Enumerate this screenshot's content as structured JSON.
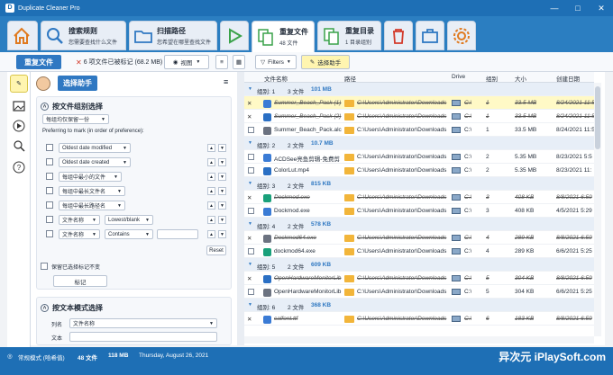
{
  "window": {
    "title": "Duplicate Cleaner Pro"
  },
  "ribbon": {
    "tabs": [
      {
        "title": "搜索规则",
        "subtitle": "您需要查找什么文件"
      },
      {
        "title": "扫描路径",
        "subtitle": "您希望在哪里查找文件"
      },
      {
        "title": "重复文件",
        "subtitle": "48 文件"
      },
      {
        "title": "重复目录",
        "subtitle": "1 目录组别"
      }
    ]
  },
  "toolbar": {
    "dup_button": "重复文件",
    "marked_summary": "6 项文件已被标记 (68.2 MB)",
    "view_label": "视图",
    "filters_label": "Filters",
    "selection_assistant": "选择助手"
  },
  "left": {
    "helper_title": "选择助手",
    "group_section": {
      "title": "按文件组别选择",
      "mode_value": "每组均仅保留一份",
      "prefer_label": "Preferring to mark (in order of preference):",
      "rules": [
        {
          "field": "Oldest date modified"
        },
        {
          "field": "Oldest date created"
        },
        {
          "field": "每组中最小的文件"
        },
        {
          "field": "每组中最长文件名"
        },
        {
          "field": "每组中最长路径名"
        },
        {
          "field": "文件名称",
          "operator": "Lowest/blank"
        },
        {
          "field": "文件名称",
          "operator": "Contains"
        }
      ],
      "reset_label": "Reset",
      "keep_marks_label": "保留已选择标记不变",
      "mark_button": "标记"
    },
    "text_section": {
      "title": "按文本模式选择",
      "column_label": "列名",
      "column_value": "文件名称",
      "text_label": "文本"
    }
  },
  "grid": {
    "headers": [
      "文件名称",
      "路径",
      "Drive",
      "组别",
      "大小",
      "创建日期"
    ],
    "rows": [
      {
        "type": "group",
        "label": "组别: 1",
        "count": "3 文件",
        "size": "101 MB"
      },
      {
        "type": "file",
        "marked": true,
        "highlight": true,
        "name": "Summer_Beach_Pack (1)",
        "path": "C:\\Users\\Administrator\\Downloads",
        "drive": "C:\\",
        "group": "1",
        "size": "33.5 MB",
        "date": "8/24/2021 11:5"
      },
      {
        "type": "file",
        "marked": true,
        "name": "Summer_Beach_Pack (2)",
        "path": "C:\\Users\\Administrator\\Downloads",
        "drive": "C:\\",
        "group": "1",
        "size": "33.5 MB",
        "date": "8/24/2021 11:5"
      },
      {
        "type": "file",
        "marked": false,
        "name": "Summer_Beach_Pack.alc",
        "path": "C:\\Users\\Administrator\\Downloads",
        "drive": "C:\\",
        "group": "1",
        "size": "33.5 MB",
        "date": "8/24/2021 11:5"
      },
      {
        "type": "group",
        "label": "组别: 2",
        "count": "2 文件",
        "size": "10.7 MB"
      },
      {
        "type": "file",
        "marked": false,
        "name": "ACDSee亮鱼剪辑-免费剪",
        "path": "C:\\Users\\Administrator\\Downloads",
        "drive": "C:\\",
        "group": "2",
        "size": "5.35 MB",
        "date": "8/23/2021 5:5"
      },
      {
        "type": "file",
        "marked": false,
        "name": "ColorLut.mp4",
        "path": "C:\\Users\\Administrator\\Downloads",
        "drive": "C:\\",
        "group": "2",
        "size": "5.35 MB",
        "date": "8/23/2021 11:"
      },
      {
        "type": "group",
        "label": "组别: 3",
        "count": "2 文件",
        "size": "815 KB"
      },
      {
        "type": "file",
        "marked": true,
        "name": "Dockmod.exe",
        "path": "C:\\Users\\Administrator\\Downloads",
        "drive": "C:\\",
        "group": "3",
        "size": "408 KB",
        "date": "8/8/2021 6:59"
      },
      {
        "type": "file",
        "marked": false,
        "name": "Dockmod.exe",
        "path": "C:\\Users\\Administrator\\Downloads",
        "drive": "C:\\",
        "group": "3",
        "size": "408 KB",
        "date": "4/5/2021 5:29"
      },
      {
        "type": "group",
        "label": "组别: 4",
        "count": "2 文件",
        "size": "578 KB"
      },
      {
        "type": "file",
        "marked": true,
        "name": "Dockmod64.exe",
        "path": "C:\\Users\\Administrator\\Downloads",
        "drive": "C:\\",
        "group": "4",
        "size": "289 KB",
        "date": "8/8/2021 6:59"
      },
      {
        "type": "file",
        "marked": false,
        "name": "dockmod64.exe",
        "path": "C:\\Users\\Administrator\\Downloads",
        "drive": "C:\\",
        "group": "4",
        "size": "289 KB",
        "date": "6/6/2021 5:25"
      },
      {
        "type": "group",
        "label": "组别: 5",
        "count": "2 文件",
        "size": "609 KB"
      },
      {
        "type": "file",
        "marked": true,
        "name": "OpenHardwareMonitorLib",
        "path": "C:\\Users\\Administrator\\Downloads",
        "drive": "C:\\",
        "group": "5",
        "size": "304 KB",
        "date": "8/8/2021 6:59"
      },
      {
        "type": "file",
        "marked": false,
        "name": "OpenHardwareMonitorLib",
        "path": "C:\\Users\\Administrator\\Downloads",
        "drive": "C:\\",
        "group": "5",
        "size": "304 KB",
        "date": "6/6/2021 5:25"
      },
      {
        "type": "group",
        "label": "组别: 6",
        "count": "2 文件",
        "size": "368 KB"
      },
      {
        "type": "file",
        "marked": true,
        "name": "calfont.ttf",
        "path": "C:\\Users\\Administrator\\Downloads",
        "drive": "C:\\",
        "group": "6",
        "size": "183 KB",
        "date": "8/8/2021 6:59"
      }
    ]
  },
  "status": {
    "mode": "常规模式 (哈希值)",
    "files": "48 文件",
    "size": "118 MB",
    "date": "Thursday, August 26, 2021",
    "watermark": "异次元 iPlaySoft.com"
  }
}
